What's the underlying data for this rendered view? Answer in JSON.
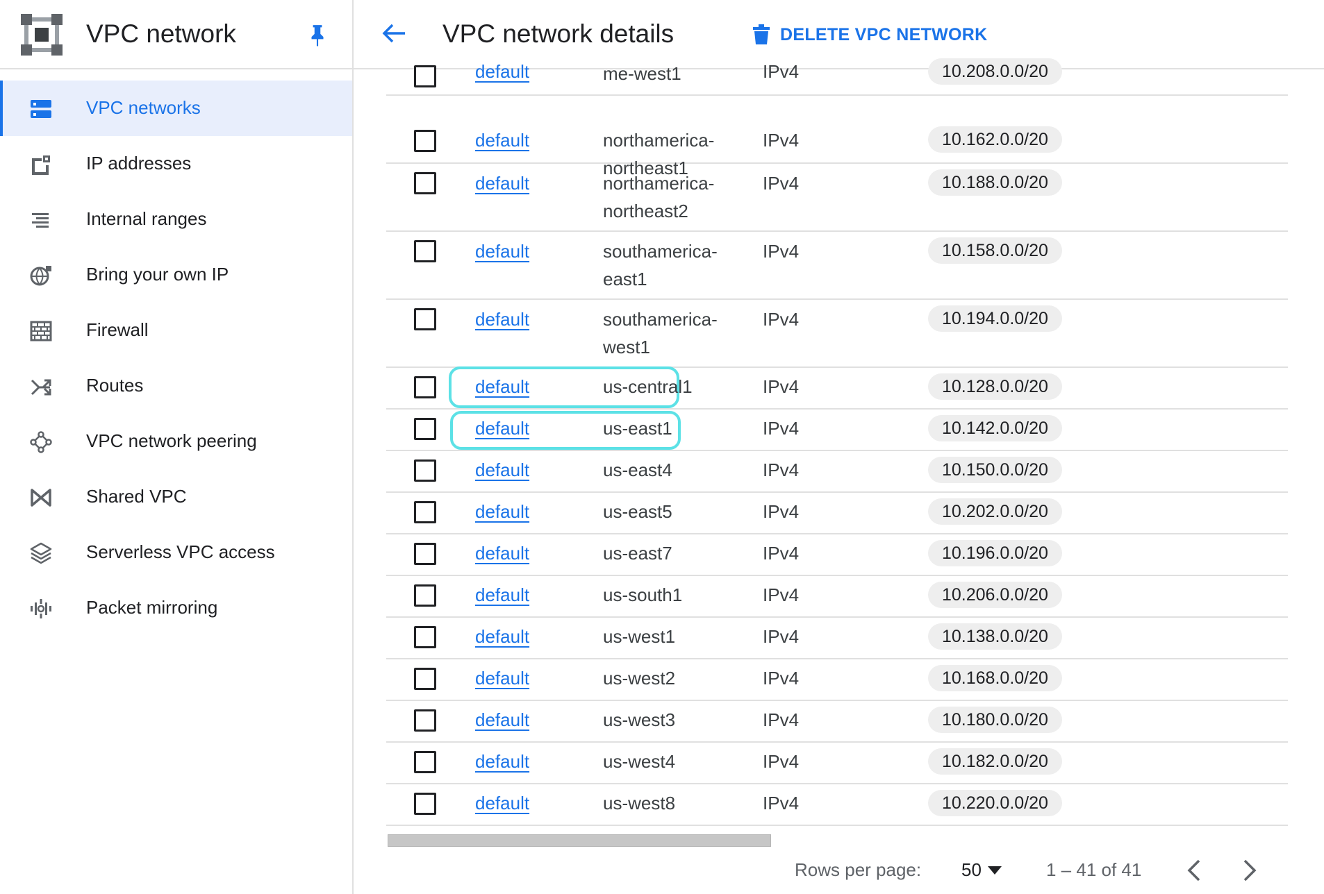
{
  "app": {
    "title": "VPC network"
  },
  "sidebar": {
    "items": [
      {
        "label": "VPC networks",
        "icon": "vpc-networks-icon",
        "active": true
      },
      {
        "label": "IP addresses",
        "icon": "ip-addresses-icon",
        "active": false
      },
      {
        "label": "Internal ranges",
        "icon": "internal-ranges-icon",
        "active": false
      },
      {
        "label": "Bring your own IP",
        "icon": "globe-icon",
        "active": false
      },
      {
        "label": "Firewall",
        "icon": "firewall-icon",
        "active": false
      },
      {
        "label": "Routes",
        "icon": "routes-icon",
        "active": false
      },
      {
        "label": "VPC network peering",
        "icon": "peering-icon",
        "active": false
      },
      {
        "label": "Shared VPC",
        "icon": "shared-vpc-icon",
        "active": false
      },
      {
        "label": "Serverless VPC access",
        "icon": "serverless-icon",
        "active": false
      },
      {
        "label": "Packet mirroring",
        "icon": "packet-mirroring-icon",
        "active": false
      }
    ]
  },
  "header": {
    "title": "VPC network details",
    "delete_label": "DELETE VPC NETWORK"
  },
  "table": {
    "rows": [
      {
        "network": "default",
        "region": "me-west1",
        "stack": "IPv4",
        "range": "10.208.0.0/20"
      },
      {
        "network": "default",
        "region": "northamerica-northeast1",
        "stack": "IPv4",
        "range": "10.162.0.0/20"
      },
      {
        "network": "default",
        "region": "northamerica-northeast2",
        "stack": "IPv4",
        "range": "10.188.0.0/20"
      },
      {
        "network": "default",
        "region": "southamerica-east1",
        "stack": "IPv4",
        "range": "10.158.0.0/20"
      },
      {
        "network": "default",
        "region": "southamerica-west1",
        "stack": "IPv4",
        "range": "10.194.0.0/20"
      },
      {
        "network": "default",
        "region": "us-central1",
        "stack": "IPv4",
        "range": "10.128.0.0/20",
        "highlighted": true
      },
      {
        "network": "default",
        "region": "us-east1",
        "stack": "IPv4",
        "range": "10.142.0.0/20",
        "highlighted": true
      },
      {
        "network": "default",
        "region": "us-east4",
        "stack": "IPv4",
        "range": "10.150.0.0/20"
      },
      {
        "network": "default",
        "region": "us-east5",
        "stack": "IPv4",
        "range": "10.202.0.0/20"
      },
      {
        "network": "default",
        "region": "us-east7",
        "stack": "IPv4",
        "range": "10.196.0.0/20"
      },
      {
        "network": "default",
        "region": "us-south1",
        "stack": "IPv4",
        "range": "10.206.0.0/20"
      },
      {
        "network": "default",
        "region": "us-west1",
        "stack": "IPv4",
        "range": "10.138.0.0/20"
      },
      {
        "network": "default",
        "region": "us-west2",
        "stack": "IPv4",
        "range": "10.168.0.0/20"
      },
      {
        "network": "default",
        "region": "us-west3",
        "stack": "IPv4",
        "range": "10.180.0.0/20"
      },
      {
        "network": "default",
        "region": "us-west4",
        "stack": "IPv4",
        "range": "10.182.0.0/20"
      },
      {
        "network": "default",
        "region": "us-west8",
        "stack": "IPv4",
        "range": "10.220.0.0/20"
      }
    ]
  },
  "pagination": {
    "rows_per_page_label": "Rows per page:",
    "rows_per_page": "50",
    "range_text": "1 – 41 of 41"
  },
  "colors": {
    "accent": "#1a73e8",
    "highlight": "#5ce1e6",
    "chip": "#eeeeee"
  }
}
